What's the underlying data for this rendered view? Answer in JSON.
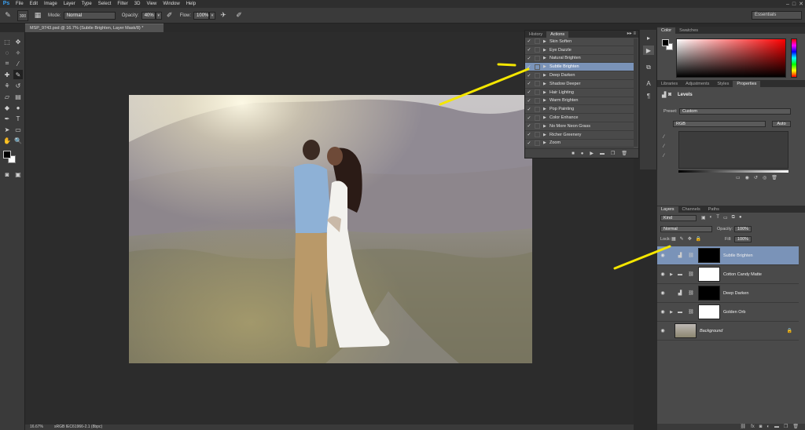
{
  "app": {
    "logo": "Ps"
  },
  "menu": [
    "File",
    "Edit",
    "Image",
    "Layer",
    "Type",
    "Select",
    "Filter",
    "3D",
    "View",
    "Window",
    "Help"
  ],
  "window_controls": [
    "–",
    "□",
    "✕"
  ],
  "options": {
    "brush_size": "300",
    "mode_label": "Mode:",
    "mode_value": "Normal",
    "opacity_label": "Opacity:",
    "opacity_value": "40%",
    "flow_label": "Flow:",
    "flow_value": "100%",
    "workspace": "Essentials"
  },
  "document": {
    "tab_title": "MSP_9743.psd @ 16.7% (Subtle Brighten, Layer Mask/8) *",
    "zoom": "16.67%",
    "doc_info": "sRGB IEC61966-2.1 (8bpc)"
  },
  "actions_panel": {
    "tabs": [
      "History",
      "Actions"
    ],
    "active_tab": "Actions",
    "menu_icon": "▸▸ ≡",
    "items": [
      {
        "label": "Skin Soften",
        "selected": false
      },
      {
        "label": "Eye Dazzle",
        "selected": false
      },
      {
        "label": "Natural Brighten",
        "selected": false
      },
      {
        "label": "Subtle Brighten",
        "selected": true
      },
      {
        "label": "Deep Darken",
        "selected": false
      },
      {
        "label": "Shadow Deeper",
        "selected": false
      },
      {
        "label": "Hair Lighting",
        "selected": false
      },
      {
        "label": "Warm Brighten",
        "selected": false
      },
      {
        "label": "Pop Painting",
        "selected": false
      },
      {
        "label": "Color Enhance",
        "selected": false
      },
      {
        "label": "No More Neon Grass",
        "selected": false
      },
      {
        "label": "Richer Greenery",
        "selected": false
      },
      {
        "label": "Zoom",
        "selected": false
      }
    ],
    "bottom_icons": [
      "stop-icon",
      "record-icon",
      "play-icon",
      "new-set-icon",
      "new-action-icon",
      "delete-icon"
    ]
  },
  "color_panel": {
    "tabs": [
      "Color",
      "Swatches"
    ]
  },
  "props_panel": {
    "tabs": [
      "Libraries",
      "Adjustments",
      "Styles",
      "Properties"
    ],
    "active_tab": "Properties",
    "title": "Levels",
    "preset_label": "Preset:",
    "preset_value": "Custom",
    "channel_value": "RGB",
    "auto_label": "Auto"
  },
  "layers_panel": {
    "tabs": [
      "Layers",
      "Channels",
      "Paths"
    ],
    "kind_label": "Kind",
    "blend_mode": "Normal",
    "opacity_label": "Opacity:",
    "opacity_value": "100%",
    "lock_label": "Lock:",
    "fill_label": "Fill:",
    "fill_value": "100%",
    "layers": [
      {
        "name": "Subtle Brighten",
        "type": "adjustment",
        "selected": true
      },
      {
        "name": "Cotton Candy Matte",
        "type": "group",
        "selected": false
      },
      {
        "name": "Deep Darken",
        "type": "adjustment",
        "selected": false
      },
      {
        "name": "Golden Orb",
        "type": "group",
        "selected": false
      },
      {
        "name": "Background",
        "type": "background",
        "selected": false
      }
    ]
  },
  "colors": {
    "selection": "#7a93b8",
    "annotation": "#f4e600"
  }
}
